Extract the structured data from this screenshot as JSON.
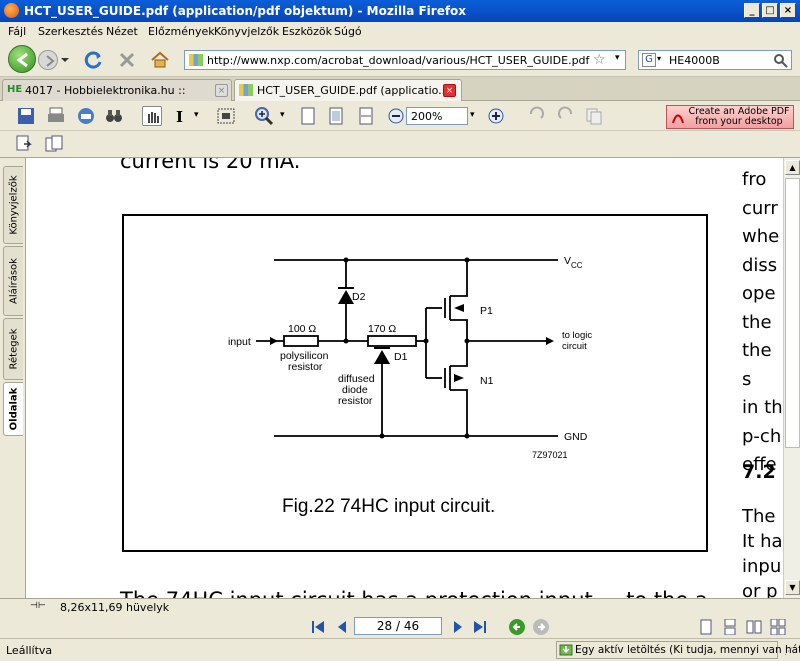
{
  "window": {
    "title": "HCT_USER_GUIDE.pdf (application/pdf objektum) - Mozilla Firefox"
  },
  "menu": [
    "Fájl",
    "Szerkesztés",
    "Nézet",
    "Előzmények",
    "Könyvjelzők",
    "Eszközök",
    "Súgó"
  ],
  "nav": {
    "url": "http://www.nxp.com/acrobat_download/various/HCT_USER_GUIDE.pdf",
    "search": "HE4000B"
  },
  "tabs": [
    {
      "favicon": "HE",
      "label": "4017 - Hobbielektronika.hu ::"
    },
    {
      "label": "HCT_USER_GUIDE.pdf (applicatio..."
    }
  ],
  "pdf_toolbar": {
    "zoom": "200%",
    "adobe_line1": "Create an Adobe PDF",
    "adobe_line2": "from your desktop"
  },
  "sidebar_tabs": [
    "Könyvjelzők",
    "Aláírások",
    "Rétegek",
    "Oldalak"
  ],
  "document": {
    "top_text": "current is 20 mA.",
    "right_lines": [
      "fro",
      "curr",
      "whe",
      "diss",
      "ope",
      "the",
      "the s",
      "in th",
      "p-ch",
      "effe"
    ],
    "section_number": "7.2",
    "right_lines_2": [
      "The",
      "It ha",
      "inpu",
      "or p"
    ],
    "bottom_text": "The 74HC input circuit has a protection input ... to the a...",
    "circuit": {
      "vcc": "V",
      "vcc_sub": "CC",
      "gnd": "GND",
      "input": "input",
      "r1_value": "100 Ω",
      "r1_line1": "polysilicon",
      "r1_line2": "resistor",
      "r2_value": "170 Ω",
      "r2_line1": "diffused",
      "r2_line2": "diode",
      "r2_line3": "resistor",
      "d1": "D1",
      "d2": "D2",
      "p1": "P1",
      "n1": "N1",
      "out1": "to logic",
      "out2": "circuit",
      "code": "7Z97021",
      "caption": "Fig.22  74HC input circuit."
    }
  },
  "bottom": {
    "page_size": "8,26x11,69 hüvelyk",
    "page": "28 / 46"
  },
  "status": {
    "left": "Leállítva",
    "download": "Egy aktív letöltés (Ki tudja, mennyi van hátra...)"
  }
}
